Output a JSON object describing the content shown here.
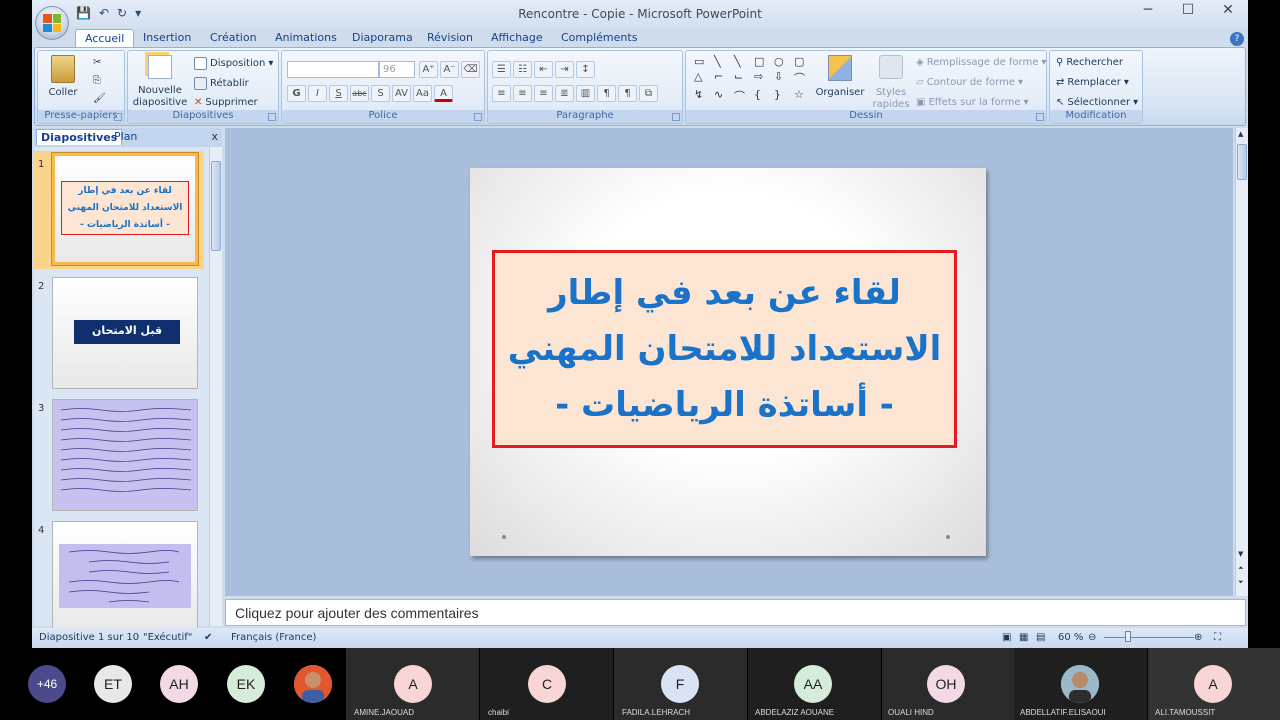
{
  "window": {
    "title": "Rencontre - Copie - Microsoft PowerPoint",
    "controls": [
      "─",
      "☐",
      "✕"
    ]
  },
  "tabs": [
    "Accueil",
    "Insertion",
    "Création",
    "Animations",
    "Diaporama",
    "Révision",
    "Affichage",
    "Compléments"
  ],
  "ribbon": {
    "clipboard": {
      "label": "Presse-papiers",
      "paste": "Coller"
    },
    "slides": {
      "label": "Diapositives",
      "new_slide_1": "Nouvelle",
      "new_slide_2": "diapositive",
      "layout": "Disposition",
      "reset": "Rétablir",
      "delete": "Supprimer"
    },
    "font": {
      "label": "Police",
      "size": "96",
      "bold": "G",
      "italic": "I",
      "underline": "S",
      "strike": "abc",
      "shadow": "S"
    },
    "paragraph": {
      "label": "Paragraphe"
    },
    "drawing": {
      "label": "Dessin",
      "arrange": "Organiser",
      "styles_1": "Styles",
      "styles_2": "rapides",
      "fill": "Remplissage de forme",
      "outline": "Contour de forme",
      "effects": "Effets sur la forme"
    },
    "editing": {
      "label": "Modification",
      "find": "Rechercher",
      "replace": "Remplacer",
      "select": "Sélectionner"
    }
  },
  "left_pane": {
    "tab_slides": "Diapositives",
    "tab_outline": "Plan",
    "close": "x",
    "thumbnails": [
      {
        "num": "1",
        "lines": [
          "لقاء عن بعد في إطار",
          "الاستعداد للامتحان المهني",
          "- أساتذة الرياضيات -"
        ]
      },
      {
        "num": "2",
        "title": "قبل الامتحان"
      },
      {
        "num": "3"
      },
      {
        "num": "4"
      }
    ]
  },
  "slide": {
    "lines": [
      "لقاء عن بعد في إطار",
      "الاستعداد للامتحان المهني",
      "- أساتذة الرياضيات -"
    ]
  },
  "notes_placeholder": "Cliquez pour ajouter des commentaires",
  "status_bar": {
    "slide_info": "Diapositive 1 sur 10",
    "theme": "\"Exécutif\"",
    "language": "Français (France)",
    "zoom": "60 %"
  },
  "meeting": {
    "more_count": "+46",
    "participants": [
      {
        "initials": "ET",
        "name": ""
      },
      {
        "initials": "AH",
        "name": ""
      },
      {
        "initials": "EK",
        "name": ""
      },
      {
        "initials": "",
        "name": ""
      },
      {
        "initials": "A",
        "name": "AMINE.JAOUAD"
      },
      {
        "initials": "C",
        "name": "chaibi"
      },
      {
        "initials": "F",
        "name": "FADILA.LEHRACH"
      },
      {
        "initials": "AA",
        "name": "ABDELAZIZ AOUANE"
      },
      {
        "initials": "OH",
        "name": "OUALI HIND"
      },
      {
        "initials": "",
        "name": "ABDELLATIF.ELISAOUI"
      },
      {
        "initials": "A",
        "name": "ALI.TAMOUSSIT"
      }
    ]
  },
  "colors": {
    "accent": "#1a73c8",
    "slide_border": "#e51b23",
    "slide_box_fill": "#fde5d3",
    "selection": "#f8b94c"
  }
}
